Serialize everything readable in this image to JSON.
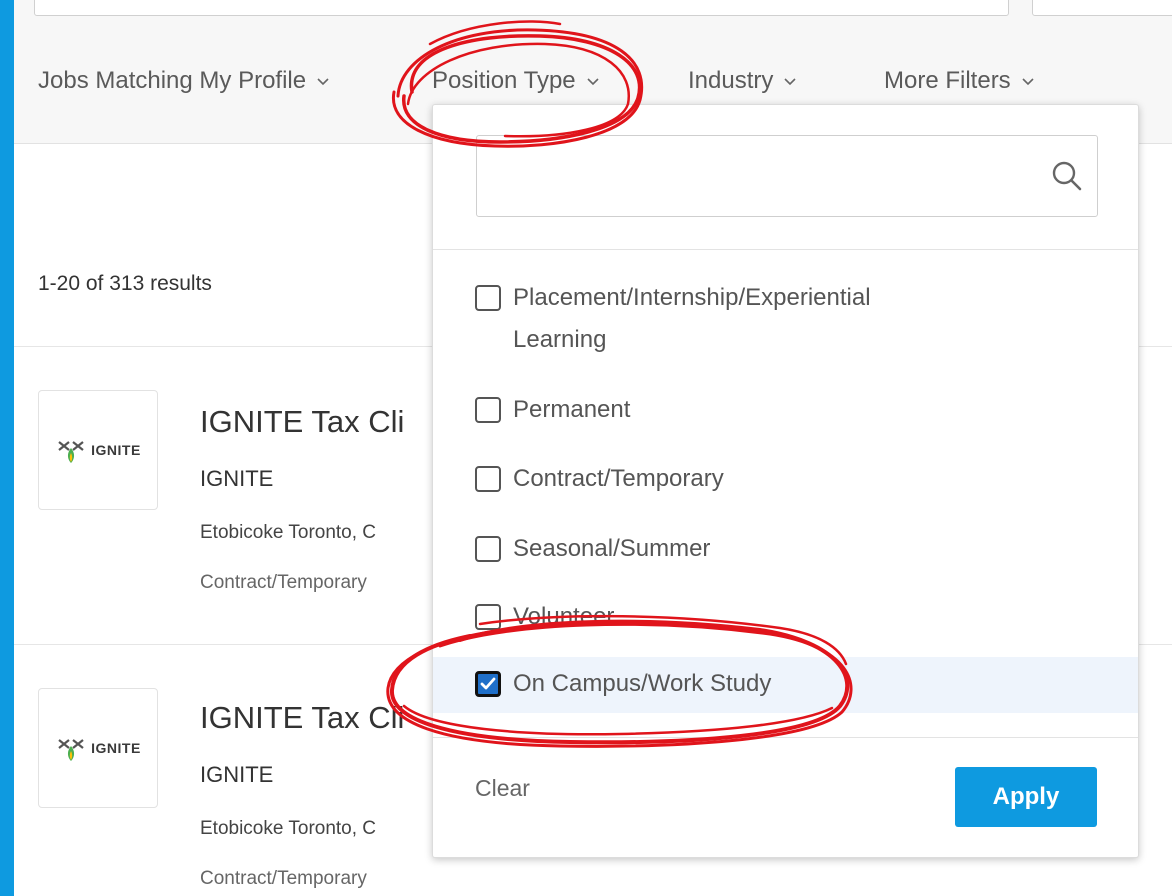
{
  "filters": [
    {
      "label": "Jobs Matching My Profile"
    },
    {
      "label": "Position Type"
    },
    {
      "label": "Industry"
    },
    {
      "label": "More Filters"
    }
  ],
  "results": {
    "count_text": "1-20 of 313 results"
  },
  "jobs": [
    {
      "logo_text": "IGNITE",
      "title": "IGNITE Tax Cli",
      "company": "IGNITE",
      "location": "Etobicoke Toronto, C",
      "type": "Contract/Temporary"
    },
    {
      "logo_text": "IGNITE",
      "title": "IGNITE Tax Cli",
      "company": "IGNITE",
      "location": "Etobicoke Toronto, C",
      "type": "Contract/Temporary"
    }
  ],
  "dropdown": {
    "search": {
      "value": "",
      "placeholder": ""
    },
    "options": [
      {
        "label_line1": "Placement/Internship/Experiential",
        "label_line2": "Learning",
        "checked": false
      },
      {
        "label": "Permanent",
        "checked": false
      },
      {
        "label": "Contract/Temporary",
        "checked": false
      },
      {
        "label": "Seasonal/Summer",
        "checked": false
      },
      {
        "label": "Volunteer",
        "checked": false
      },
      {
        "label": "On Campus/Work Study",
        "checked": true
      }
    ],
    "clear_label": "Clear",
    "apply_label": "Apply"
  },
  "colors": {
    "accent_blue": "#0e9ae0",
    "annotation_red": "#e0141b",
    "selected_row": "#eef4fc",
    "checkbox_checked": "#1f6fc9"
  }
}
